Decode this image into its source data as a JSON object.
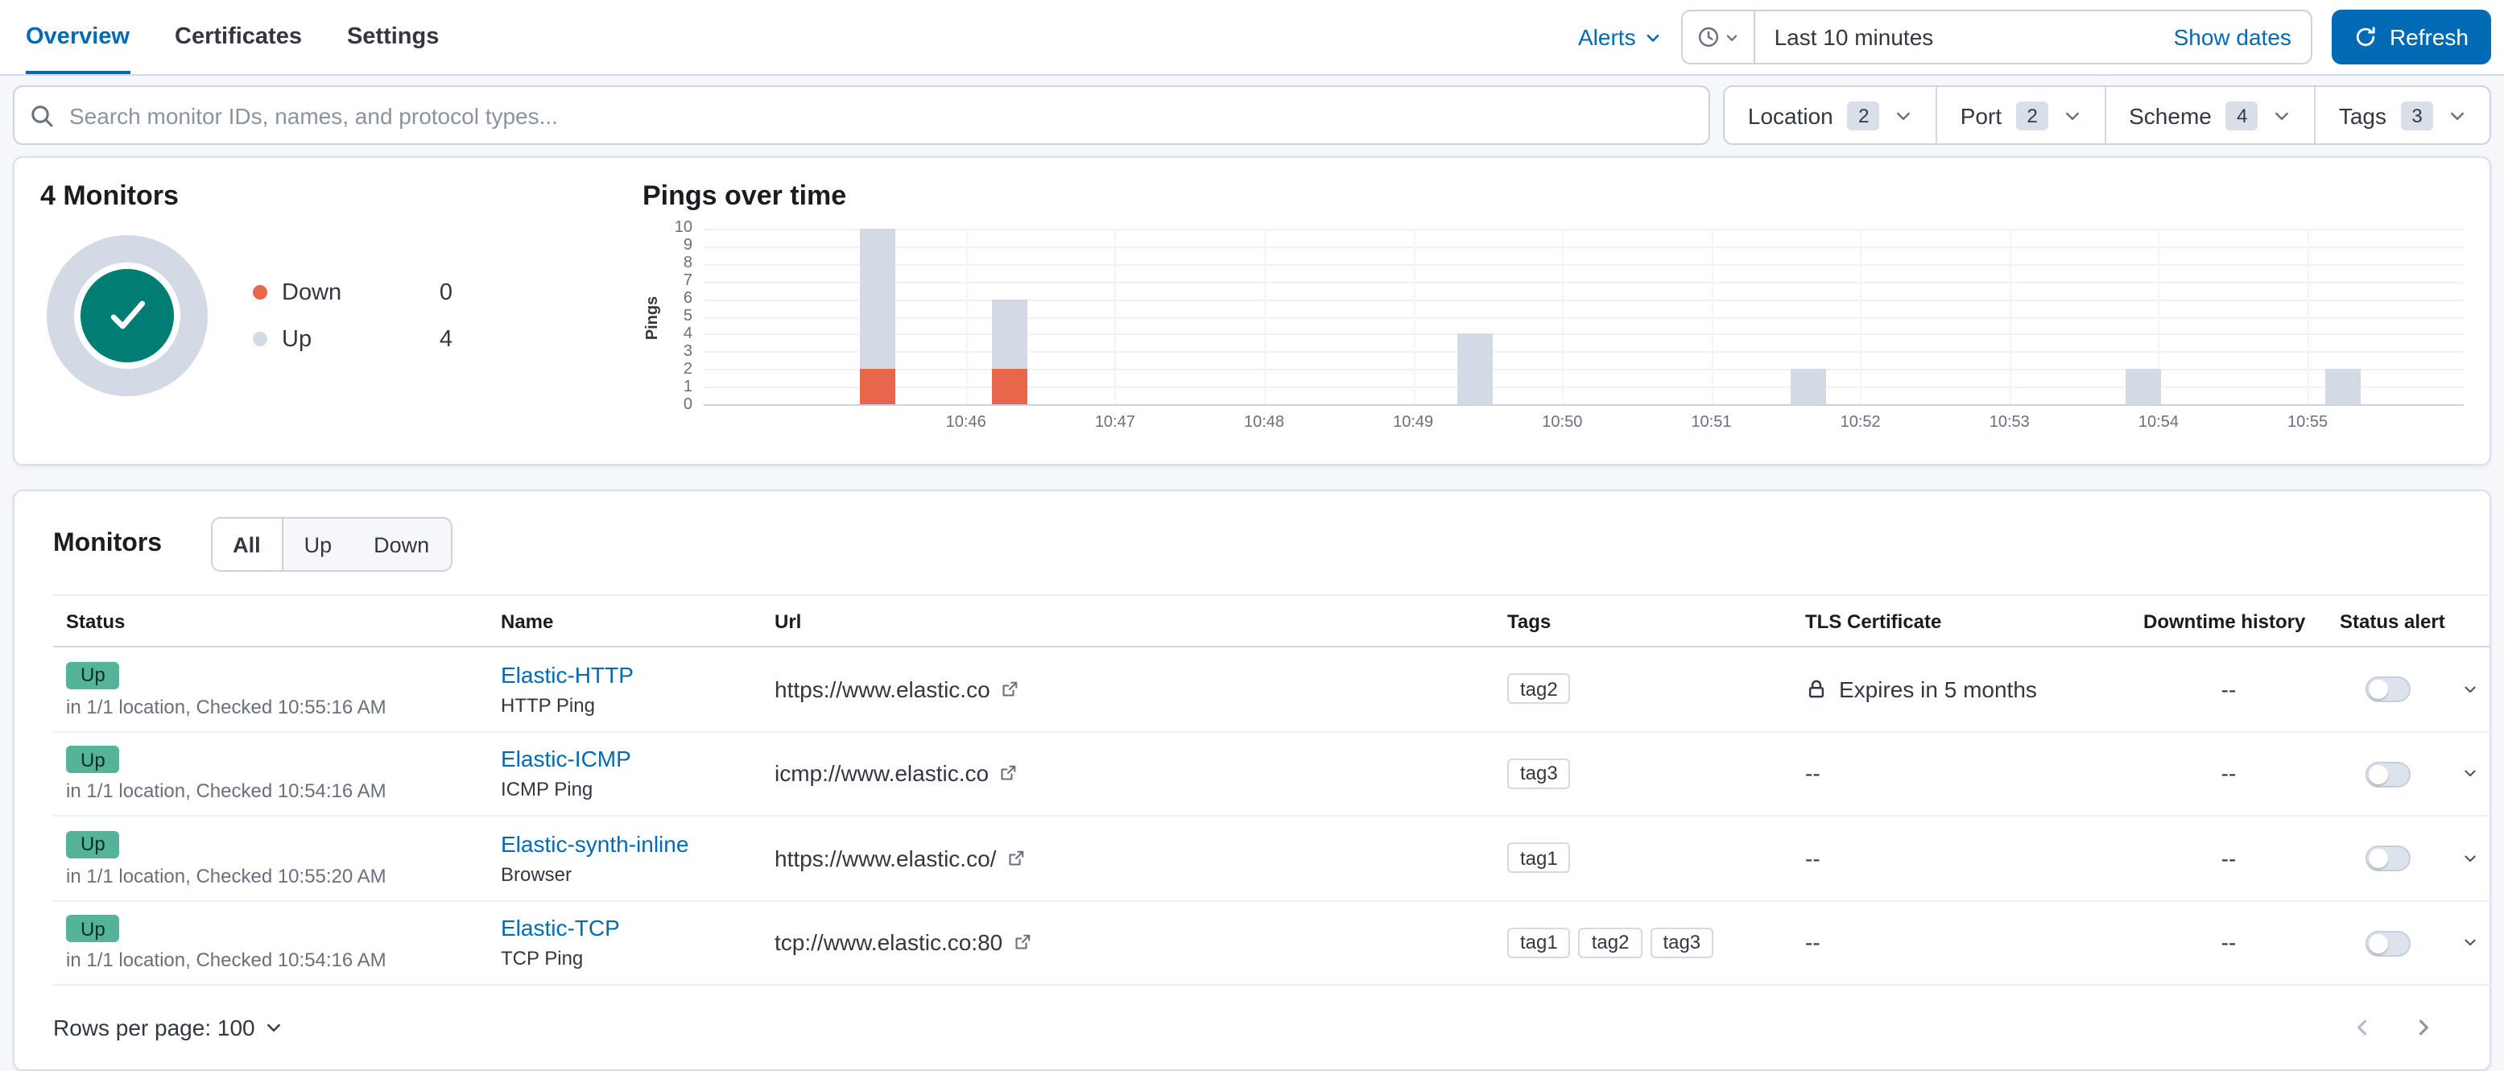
{
  "colors": {
    "primary": "#006bb4",
    "up_badge": "#54b399",
    "donut_center": "#017d73",
    "donut_ring": "#d3dae6",
    "down": "#e7664c",
    "up_bar": "#d3dae6"
  },
  "topnav": {
    "tabs": [
      {
        "label": "Overview",
        "active": true
      },
      {
        "label": "Certificates",
        "active": false
      },
      {
        "label": "Settings",
        "active": false
      }
    ],
    "alerts_label": "Alerts",
    "time_range": "Last 10 minutes",
    "show_dates_label": "Show dates",
    "refresh_label": "Refresh"
  },
  "filters": {
    "search_placeholder": "Search monitor IDs, names, and protocol types...",
    "dropdowns": [
      {
        "label": "Location",
        "count": "2"
      },
      {
        "label": "Port",
        "count": "2"
      },
      {
        "label": "Scheme",
        "count": "4"
      },
      {
        "label": "Tags",
        "count": "3"
      }
    ]
  },
  "snapshot": {
    "title": "4 Monitors",
    "legend": [
      {
        "label": "Down",
        "value": "0",
        "color": "#e7664c"
      },
      {
        "label": "Up",
        "value": "4",
        "color": "#d3dae6"
      }
    ]
  },
  "chart_data": {
    "type": "bar",
    "title": "Pings over time",
    "xlabel": "",
    "ylabel": "Pings",
    "ylim": [
      0,
      10
    ],
    "yticks": [
      0,
      1,
      2,
      3,
      4,
      5,
      6,
      7,
      8,
      9,
      10
    ],
    "xticklabels": [
      "10:46",
      "10:47",
      "10:48",
      "10:49",
      "10:50",
      "10:51",
      "10:52",
      "10:53",
      "10:54",
      "10:55"
    ],
    "grid": true,
    "legend_position": "none",
    "series": [
      {
        "name": "Up",
        "color": "#d3dae6"
      },
      {
        "name": "Down",
        "color": "#e7664c"
      }
    ],
    "bars": [
      {
        "time": "10:45:30",
        "x_pct": 9.9,
        "up": 8,
        "down": 2
      },
      {
        "time": "10:46:20",
        "x_pct": 17.4,
        "up": 4,
        "down": 2
      },
      {
        "time": "10:49:30",
        "x_pct": 43.8,
        "up": 4,
        "down": 0
      },
      {
        "time": "10:51:40",
        "x_pct": 62.8,
        "up": 2,
        "down": 0
      },
      {
        "time": "10:53:50",
        "x_pct": 81.8,
        "up": 2,
        "down": 0
      },
      {
        "time": "10:55:10",
        "x_pct": 93.1,
        "up": 2,
        "down": 0
      }
    ]
  },
  "monitors": {
    "title": "Monitors",
    "filter_buttons": [
      "All",
      "Up",
      "Down"
    ],
    "columns": [
      "Status",
      "Name",
      "Url",
      "Tags",
      "TLS Certificate",
      "Downtime history",
      "Status alert"
    ],
    "rows": [
      {
        "status": "Up",
        "status_detail": "in 1/1 location, Checked 10:55:16 AM",
        "name": "Elastic-HTTP",
        "type": "HTTP Ping",
        "url": "https://www.elastic.co",
        "tags": [
          "tag2"
        ],
        "tls": "Expires in 5 months",
        "downtime": "--",
        "status_alert_enabled": false
      },
      {
        "status": "Up",
        "status_detail": "in 1/1 location, Checked 10:54:16 AM",
        "name": "Elastic-ICMP",
        "type": "ICMP Ping",
        "url": "icmp://www.elastic.co",
        "tags": [
          "tag3"
        ],
        "tls": "--",
        "downtime": "--",
        "status_alert_enabled": false
      },
      {
        "status": "Up",
        "status_detail": "in 1/1 location, Checked 10:55:20 AM",
        "name": "Elastic-synth-inline",
        "type": "Browser",
        "url": "https://www.elastic.co/",
        "tags": [
          "tag1"
        ],
        "tls": "--",
        "downtime": "--",
        "status_alert_enabled": false
      },
      {
        "status": "Up",
        "status_detail": "in 1/1 location, Checked 10:54:16 AM",
        "name": "Elastic-TCP",
        "type": "TCP Ping",
        "url": "tcp://www.elastic.co:80",
        "tags": [
          "tag1",
          "tag2",
          "tag3"
        ],
        "tls": "--",
        "downtime": "--",
        "status_alert_enabled": false
      }
    ],
    "rows_per_page_label": "Rows per page: 100"
  }
}
